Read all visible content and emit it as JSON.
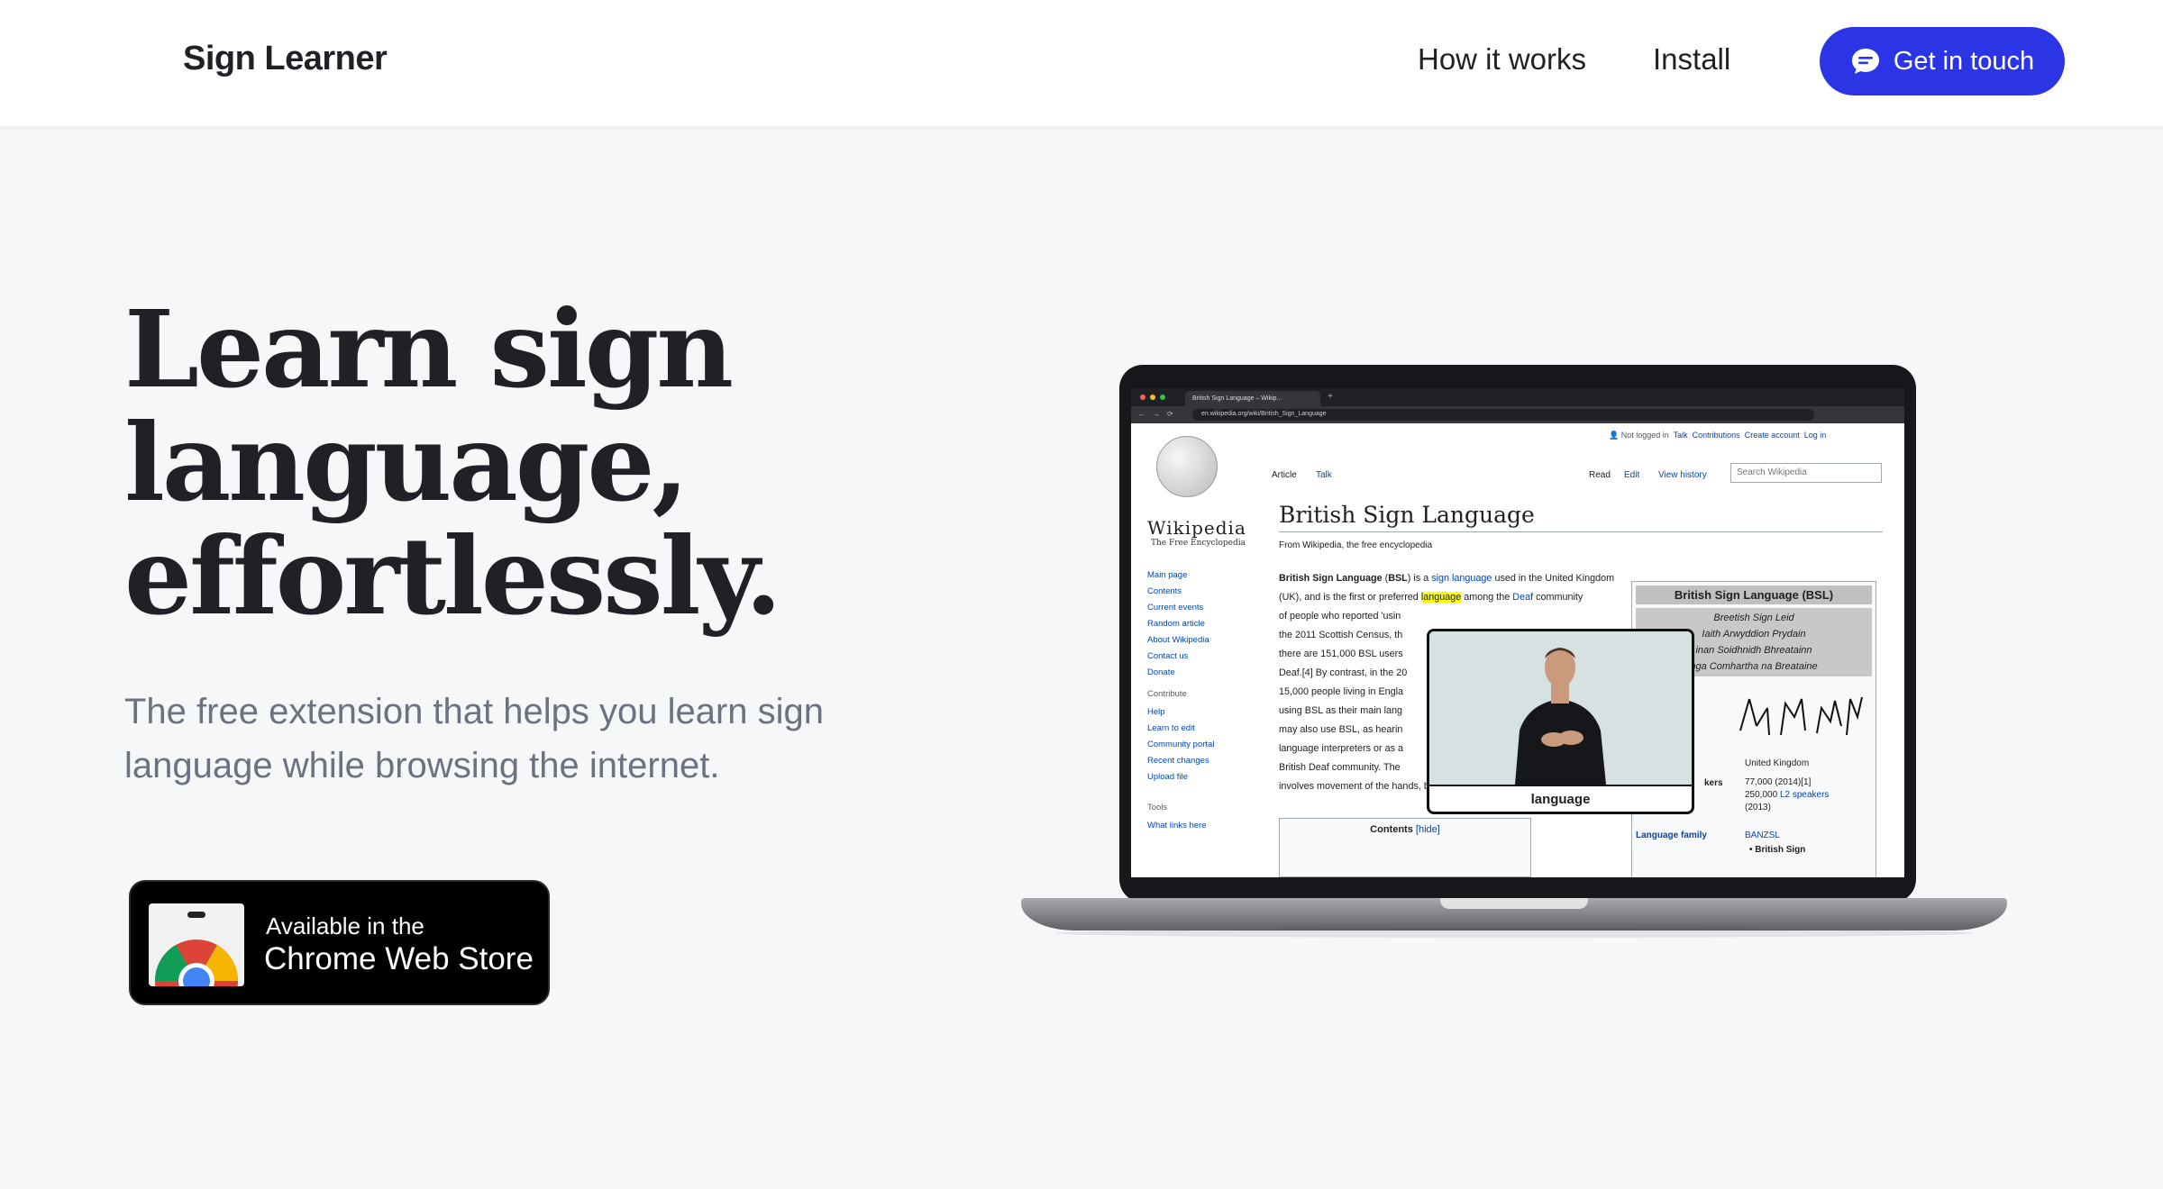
{
  "header": {
    "brand": "Sign Learner",
    "nav": {
      "how_it_works": "How it works",
      "install": "Install"
    },
    "cta_label": "Get in touch"
  },
  "hero": {
    "title_lines": [
      "Learn sign",
      "language,",
      "effortlessly."
    ],
    "subtitle": "The free extension that helps you learn sign language while browsing the internet."
  },
  "badge": {
    "line1": "Available in the",
    "line2": "Chrome Web Store"
  },
  "colors": {
    "accent": "#2b35e6",
    "background": "#f6f7f9",
    "text": "#1f2126",
    "muted": "#6b7280"
  },
  "browser": {
    "tab_title": "British Sign Language – Wikip...",
    "url": "en.wikipedia.org/wiki/British_Sign_Language"
  },
  "wiki": {
    "wordmark": "Wikipedia",
    "tagline": "The Free Encyclopedia",
    "sidebar_nav": [
      "Main page",
      "Contents",
      "Current events",
      "Random article",
      "About Wikipedia",
      "Contact us",
      "Donate"
    ],
    "contribute_heading": "Contribute",
    "contribute_links": [
      "Help",
      "Learn to edit",
      "Community portal",
      "Recent changes",
      "Upload file"
    ],
    "tools_heading": "Tools",
    "tools_links": [
      "What links here"
    ],
    "top_links": {
      "not_logged": "Not logged in",
      "talk": "Talk",
      "contributions": "Contributions",
      "create": "Create account",
      "login": "Log in"
    },
    "tabs": {
      "article": "Article",
      "talk": "Talk",
      "read": "Read",
      "edit": "Edit",
      "history": "View history"
    },
    "search_placeholder": "Search Wikipedia",
    "title": "British Sign Language",
    "from": "From Wikipedia, the free encyclopedia",
    "body": {
      "bold": "British Sign Language",
      "abbr": "BSL",
      "p1a": ") is a ",
      "link_sign": "sign language",
      "p1b": " used in the United Kingdom (UK), and is the first or preferred ",
      "highlight": "language",
      "p2a": " among the ",
      "link_deaf": "Deaf",
      "p2b": " community",
      "lines": [
        "of people who reported 'usin",
        "the 2011 Scottish Census, th",
        "there are 151,000 BSL users",
        "Deaf.[4] By contrast, in the 20",
        "15,000 people living in Engla",
        "using BSL as their main lang",
        "may also use BSL, as hearin",
        "language interpreters or as a",
        "British Deaf community. The"
      ],
      "last": "involves movement of the hands, body, face, and head."
    },
    "contents_label": "Contents",
    "contents_hide": "[hide]",
    "infobox": {
      "title": "British Sign Language (BSL)",
      "names": [
        "Breetish Sign Leid",
        "Iaith Arwyddion Prydain",
        "inan Soidhnidh Bhreatainn",
        "nga Comhartha na Breataine"
      ],
      "region_value": "United Kingdom",
      "speakers_label": "kers",
      "speakers_value1": "77,000 (2014)[1]",
      "speakers_value2": "250,000 ",
      "speakers_link": "L2 speakers",
      "speakers_value3": "(2013)",
      "family_label": "Language family",
      "family_value": "BANZSL",
      "family_sub": "• British Sign"
    }
  },
  "popup": {
    "label": "language"
  }
}
